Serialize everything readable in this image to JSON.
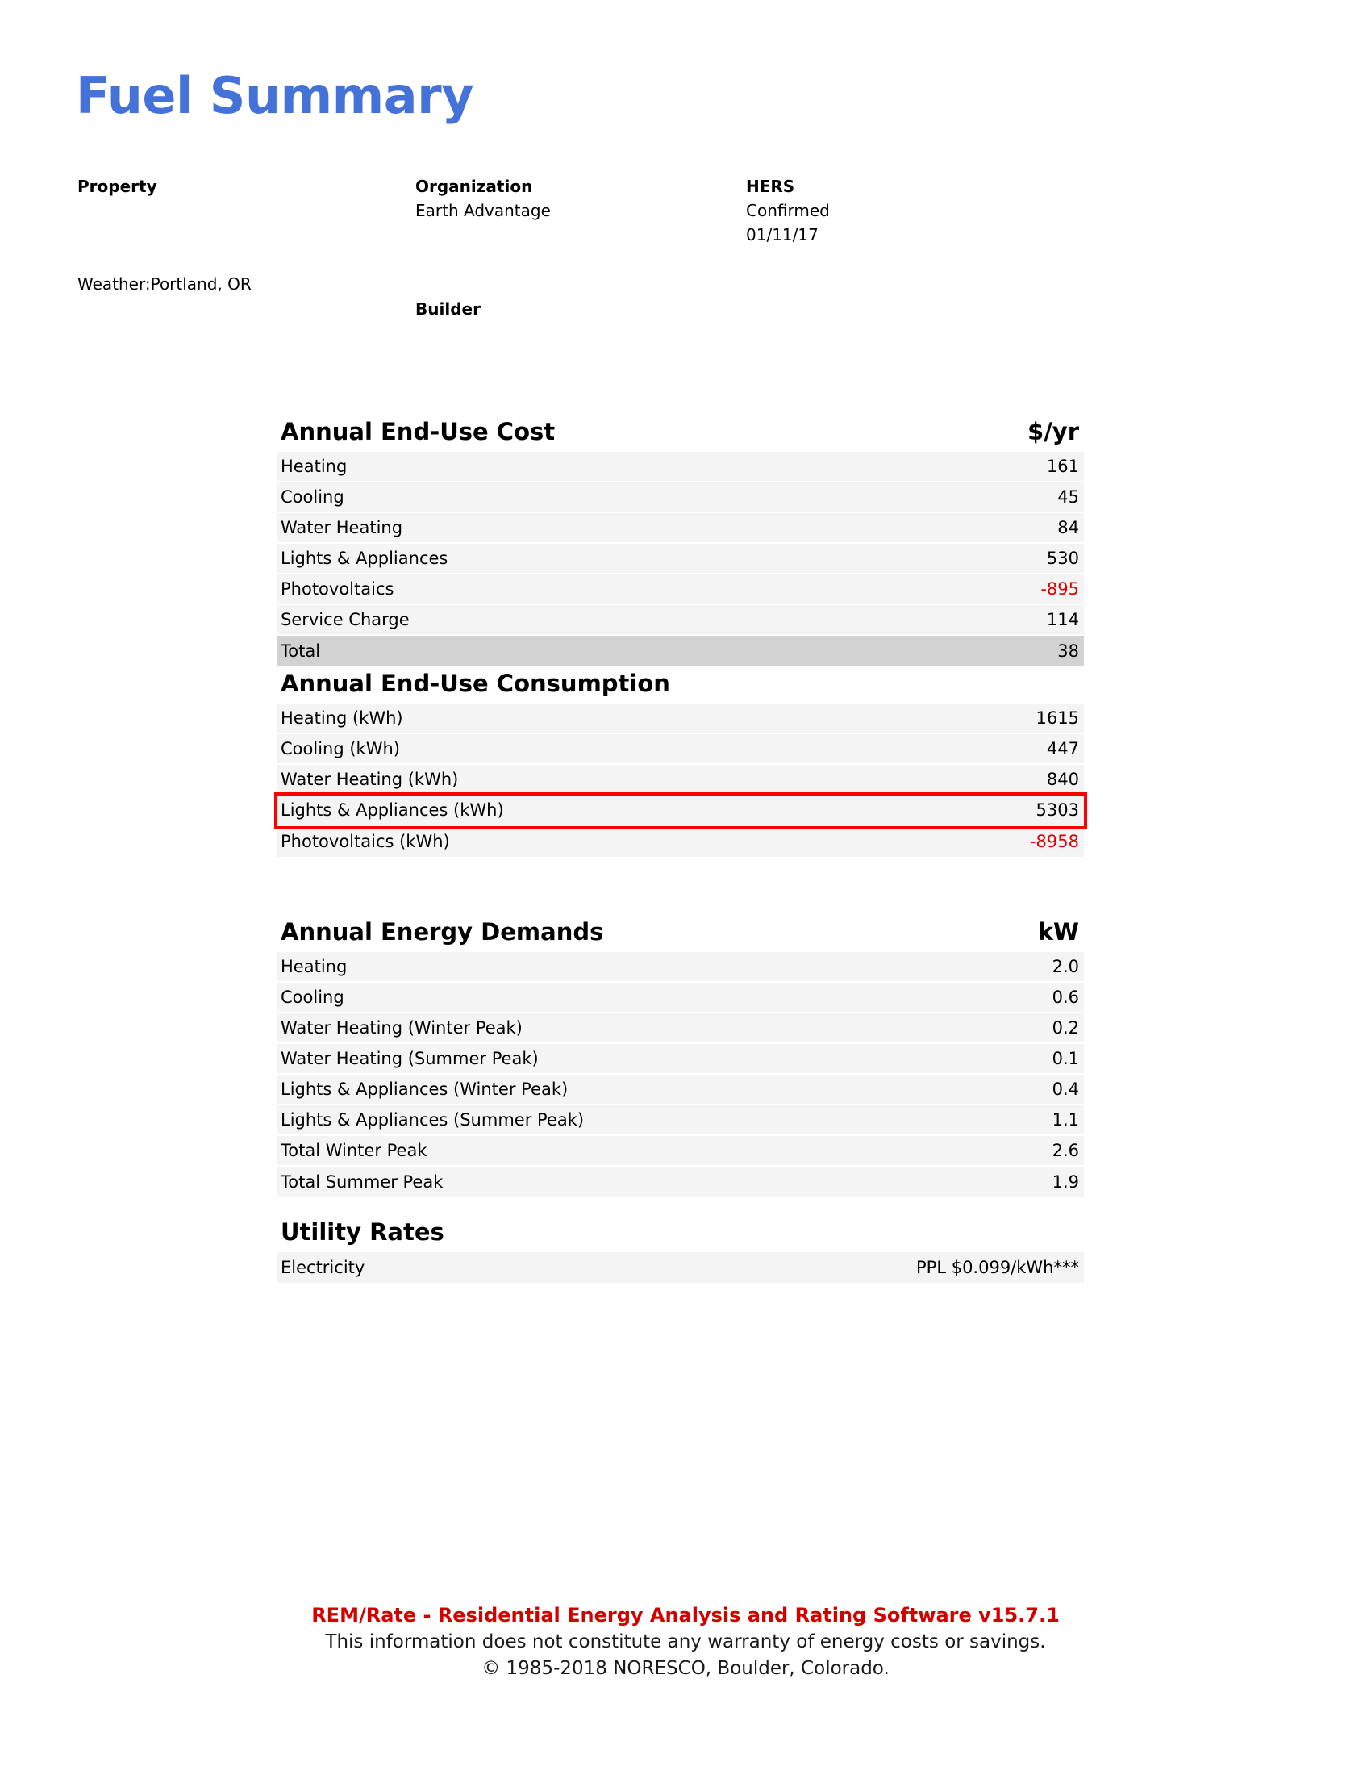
{
  "document": {
    "title": "Fuel Summary"
  },
  "header": {
    "property": {
      "label": "Property"
    },
    "weather": {
      "text": "Weather:Portland, OR"
    },
    "organization": {
      "label": "Organization",
      "value": "Earth Advantage"
    },
    "builder": {
      "label": "Builder"
    },
    "hers": {
      "label": "HERS",
      "status": "Confirmed",
      "date": "01/11/17"
    }
  },
  "sections": {
    "cost": {
      "title": "Annual End-Use Cost",
      "unit": "$/yr",
      "rows": [
        {
          "label": "Heating",
          "value": "161",
          "negative": false,
          "total": false,
          "highlighted": false
        },
        {
          "label": "Cooling",
          "value": "45",
          "negative": false,
          "total": false,
          "highlighted": false
        },
        {
          "label": "Water Heating",
          "value": "84",
          "negative": false,
          "total": false,
          "highlighted": false
        },
        {
          "label": "Lights & Appliances",
          "value": "530",
          "negative": false,
          "total": false,
          "highlighted": false
        },
        {
          "label": "Photovoltaics",
          "value": "-895",
          "negative": true,
          "total": false,
          "highlighted": false
        },
        {
          "label": "Service Charge",
          "value": "114",
          "negative": false,
          "total": false,
          "highlighted": false
        },
        {
          "label": "Total",
          "value": "38",
          "negative": false,
          "total": true,
          "highlighted": false
        }
      ]
    },
    "consumption": {
      "title": "Annual End-Use Consumption",
      "unit": "",
      "rows": [
        {
          "label": "Heating (kWh)",
          "value": "1615",
          "negative": false,
          "total": false,
          "highlighted": false
        },
        {
          "label": "Cooling (kWh)",
          "value": "447",
          "negative": false,
          "total": false,
          "highlighted": false
        },
        {
          "label": "Water Heating (kWh)",
          "value": "840",
          "negative": false,
          "total": false,
          "highlighted": false
        },
        {
          "label": "Lights & Appliances (kWh)",
          "value": "5303",
          "negative": false,
          "total": false,
          "highlighted": true
        },
        {
          "label": "Photovoltaics (kWh)",
          "value": "-8958",
          "negative": true,
          "total": false,
          "highlighted": false
        }
      ]
    },
    "demands": {
      "title": "Annual Energy Demands",
      "unit": "kW",
      "rows": [
        {
          "label": "Heating",
          "value": "2.0",
          "negative": false,
          "total": false,
          "highlighted": false
        },
        {
          "label": "Cooling",
          "value": "0.6",
          "negative": false,
          "total": false,
          "highlighted": false
        },
        {
          "label": "Water Heating (Winter Peak)",
          "value": "0.2",
          "negative": false,
          "total": false,
          "highlighted": false
        },
        {
          "label": "Water Heating (Summer Peak)",
          "value": "0.1",
          "negative": false,
          "total": false,
          "highlighted": false
        },
        {
          "label": "Lights & Appliances (Winter Peak)",
          "value": "0.4",
          "negative": false,
          "total": false,
          "highlighted": false
        },
        {
          "label": "Lights & Appliances (Summer Peak)",
          "value": "1.1",
          "negative": false,
          "total": false,
          "highlighted": false
        },
        {
          "label": "Total Winter Peak",
          "value": "2.6",
          "negative": false,
          "total": false,
          "highlighted": false
        },
        {
          "label": "Total Summer Peak",
          "value": "1.9",
          "negative": false,
          "total": false,
          "highlighted": false
        }
      ]
    },
    "rates": {
      "title": "Utility Rates",
      "unit": "",
      "rows": [
        {
          "label": "Electricity",
          "value": "PPL $0.099/kWh***",
          "negative": false,
          "total": false,
          "highlighted": false
        }
      ]
    }
  },
  "footer": {
    "line1": "REM/Rate - Residential Energy Analysis and Rating Software v15.7.1",
    "line2": "This information does not constitute any warranty of energy costs or savings.",
    "line3": "© 1985-2018 NORESCO, Boulder, Colorado."
  },
  "colors": {
    "title_blue": "#4472d8",
    "negative_red": "#e00000",
    "highlight_red": "#ff0000",
    "footer_red": "#d40000",
    "row_bg": "#f4f4f4",
    "total_bg": "#d2d2d2"
  }
}
